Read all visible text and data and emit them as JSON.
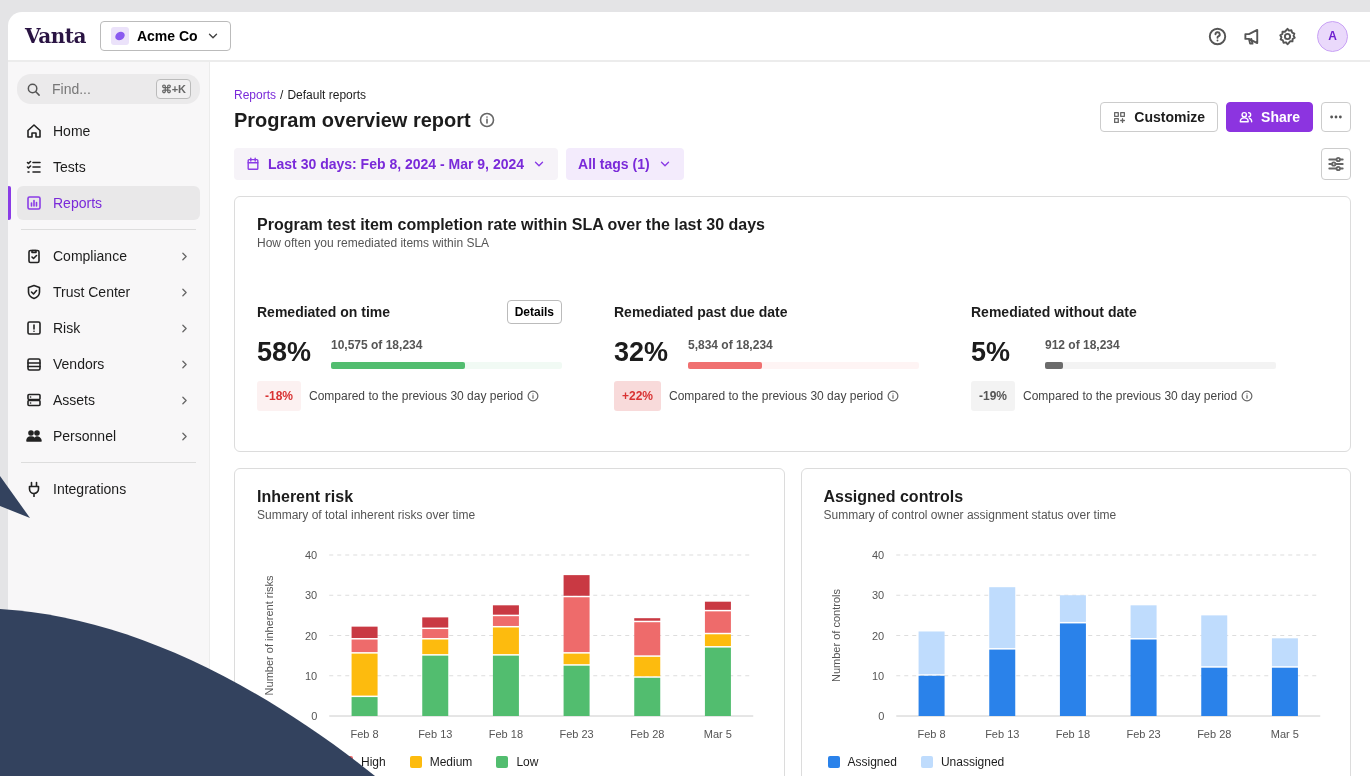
{
  "app": {
    "logo": "Vanta",
    "org": "Acme Co",
    "avatar": "A"
  },
  "search": {
    "placeholder": "Find...",
    "shortcut": "⌘+K"
  },
  "sidebar": {
    "sections": [
      {
        "items": [
          {
            "label": "Home",
            "selected": false,
            "has_submenu": false
          },
          {
            "label": "Tests",
            "selected": false,
            "has_submenu": false
          },
          {
            "label": "Reports",
            "selected": true,
            "has_submenu": false
          }
        ]
      },
      {
        "items": [
          {
            "label": "Compliance",
            "selected": false,
            "has_submenu": true
          },
          {
            "label": "Trust Center",
            "selected": false,
            "has_submenu": true
          },
          {
            "label": "Risk",
            "selected": false,
            "has_submenu": true
          },
          {
            "label": "Vendors",
            "selected": false,
            "has_submenu": true
          },
          {
            "label": "Assets",
            "selected": false,
            "has_submenu": true
          },
          {
            "label": "Personnel",
            "selected": false,
            "has_submenu": true
          }
        ]
      },
      {
        "items": [
          {
            "label": "Integrations",
            "selected": false,
            "has_submenu": false
          }
        ]
      }
    ]
  },
  "breadcrumb": [
    {
      "label": "Reports",
      "kind": "link"
    },
    {
      "label": "/",
      "kind": "separator"
    },
    {
      "label": "Default reports",
      "kind": "text"
    }
  ],
  "title": "Program overview report",
  "actions": [
    {
      "label": "Customize",
      "kind": "outline"
    },
    {
      "label": "Share",
      "kind": "primary"
    },
    {
      "kind": "more"
    }
  ],
  "filters": [
    {
      "label": "Last 30 days: Feb 8, 2024 - Mar 9, 2024",
      "kind": "date"
    },
    {
      "label": "All tags (1)",
      "kind": "tags"
    }
  ],
  "sla_card": {
    "title": "Program test item completion rate within SLA over the last 30 days",
    "subtitle": "How often you remediated items within SLA",
    "metrics": [
      {
        "label": "Remediated on time",
        "button": "Details",
        "percent": "58%",
        "count": "10,575 of 18,234",
        "level": 0.58,
        "color": "#52bd6f",
        "delta": {
          "text": "-18%",
          "color": "#d93333"
        },
        "note": "Compared to the previous 30 day period"
      },
      {
        "label": "Remediated past due date",
        "percent": "32%",
        "count": "5,834 of 18,234",
        "level": 0.32,
        "color": "#f07070",
        "delta": {
          "text": "+22%",
          "color": "#d93333"
        },
        "note": "Compared to the previous 30 day period"
      },
      {
        "label": "Remediated without date",
        "percent": "5%",
        "count": "912 of 18,234",
        "level": 0.08,
        "color": "#6b6b6b",
        "delta": {
          "text": "-19%",
          "color": "#555555"
        },
        "note": "Compared to the previous 30 day period"
      }
    ]
  },
  "charts": [
    {
      "title": "Inherent risk",
      "subtitle": "Summary of total inherent risks over time",
      "chart_data": {
        "type": "bar",
        "stacked": true,
        "grid": true,
        "legend": true,
        "ylabel": "Number of inherent risks",
        "categories": [
          "Feb 8",
          "Feb 13",
          "Feb 18",
          "Feb 23",
          "Feb 28",
          "Mar 5"
        ],
        "ylim": [
          0,
          40
        ],
        "yticks": [
          0,
          10,
          20,
          30,
          40
        ],
        "series": [
          {
            "name": "Low",
            "color": "#52bd6f",
            "values": [
              4.7,
              15,
              15,
              12.5,
              9.5,
              17
            ]
          },
          {
            "name": "Medium",
            "color": "#fdbb0e",
            "values": [
              10.8,
              4,
              7,
              3,
              5.2,
              3.3
            ]
          },
          {
            "name": "High",
            "color": "#ee6b6b",
            "values": [
              3.5,
              2.6,
              2.8,
              14,
              8.6,
              5.7
            ]
          },
          {
            "color": "#c93943",
            "values": [
              3.2,
              2.9,
              2.7,
              5.5,
              1,
              2.4
            ]
          }
        ]
      }
    },
    {
      "title": "Assigned controls",
      "subtitle": "Summary of control owner assignment status over time",
      "chart_data": {
        "type": "bar",
        "stacked": true,
        "grid": true,
        "legend": true,
        "ylabel": "Number of controls",
        "categories": [
          "Feb 8",
          "Feb 13",
          "Feb 18",
          "Feb 23",
          "Feb 28",
          "Mar 5"
        ],
        "ylim": [
          0,
          40
        ],
        "yticks": [
          0,
          10,
          20,
          30,
          40
        ],
        "series": [
          {
            "name": "Assigned",
            "color": "#2a82ea",
            "values": [
              10,
              16.5,
              23,
              19,
              12,
              12
            ]
          },
          {
            "name": "Unassigned",
            "color": "#bfdcfd",
            "values": [
              11,
              15.5,
              7,
              8.5,
              13,
              7.3
            ]
          }
        ]
      }
    }
  ]
}
